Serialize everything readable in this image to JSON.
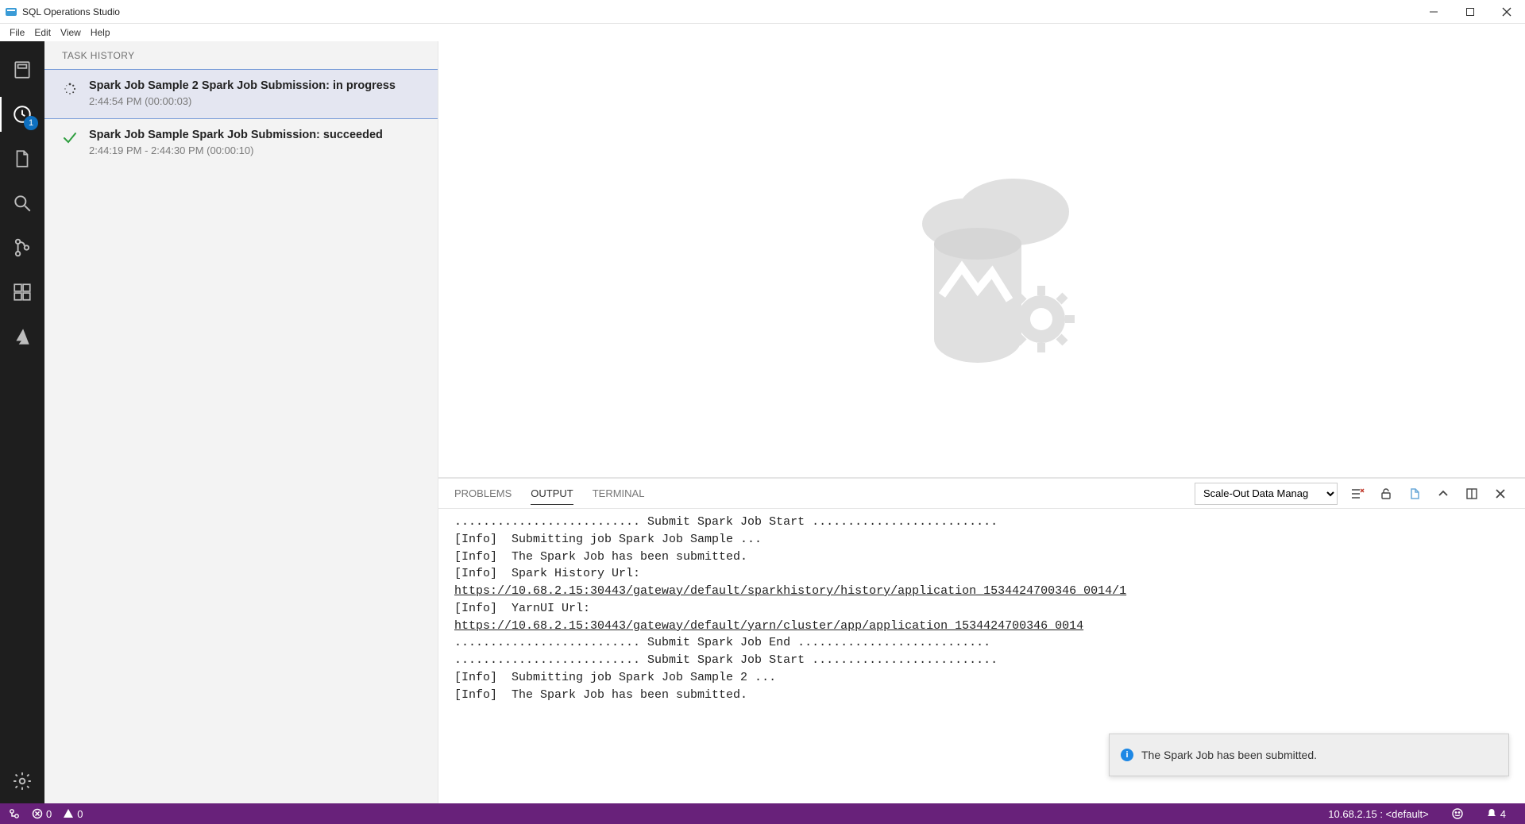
{
  "app": {
    "title": "SQL Operations Studio"
  },
  "menubar": {
    "items": [
      "File",
      "Edit",
      "View",
      "Help"
    ]
  },
  "activitybar": {
    "badge_count": "1",
    "items": [
      "servers",
      "history",
      "explorer",
      "search",
      "source-control",
      "extensions",
      "azure"
    ]
  },
  "sidebar": {
    "title": "TASK HISTORY",
    "tasks": [
      {
        "status": "in-progress",
        "title": "Spark Job Sample 2 Spark Job Submission: in progress",
        "time": "2:44:54 PM (00:00:03)"
      },
      {
        "status": "succeeded",
        "title": "Spark Job Sample Spark Job Submission: succeeded",
        "time": "2:44:19 PM - 2:44:30 PM (00:00:10)"
      }
    ]
  },
  "panel": {
    "tabs": {
      "problems": "PROBLEMS",
      "output": "OUTPUT",
      "terminal": "TERMINAL"
    },
    "output_channel": "Scale-Out Data Manag",
    "output_lines": [
      ".......................... Submit Spark Job Start ..........................",
      "[Info]  Submitting job Spark Job Sample ...",
      "[Info]  The Spark Job has been submitted.",
      "[Info]  Spark History Url:",
      "https://10.68.2.15:30443/gateway/default/sparkhistory/history/application_1534424700346_0014/1",
      "[Info]  YarnUI Url:",
      "https://10.68.2.15:30443/gateway/default/yarn/cluster/app/application_1534424700346_0014",
      ".......................... Submit Spark Job End ...........................",
      ".......................... Submit Spark Job Start ..........................",
      "[Info]  Submitting job Spark Job Sample 2 ...",
      "[Info]  The Spark Job has been submitted."
    ]
  },
  "notification": {
    "message": "The Spark Job has been submitted."
  },
  "statusbar": {
    "errors": "0",
    "warnings": "0",
    "connection": "10.68.2.15 : <default>",
    "notifications_count": "4"
  }
}
